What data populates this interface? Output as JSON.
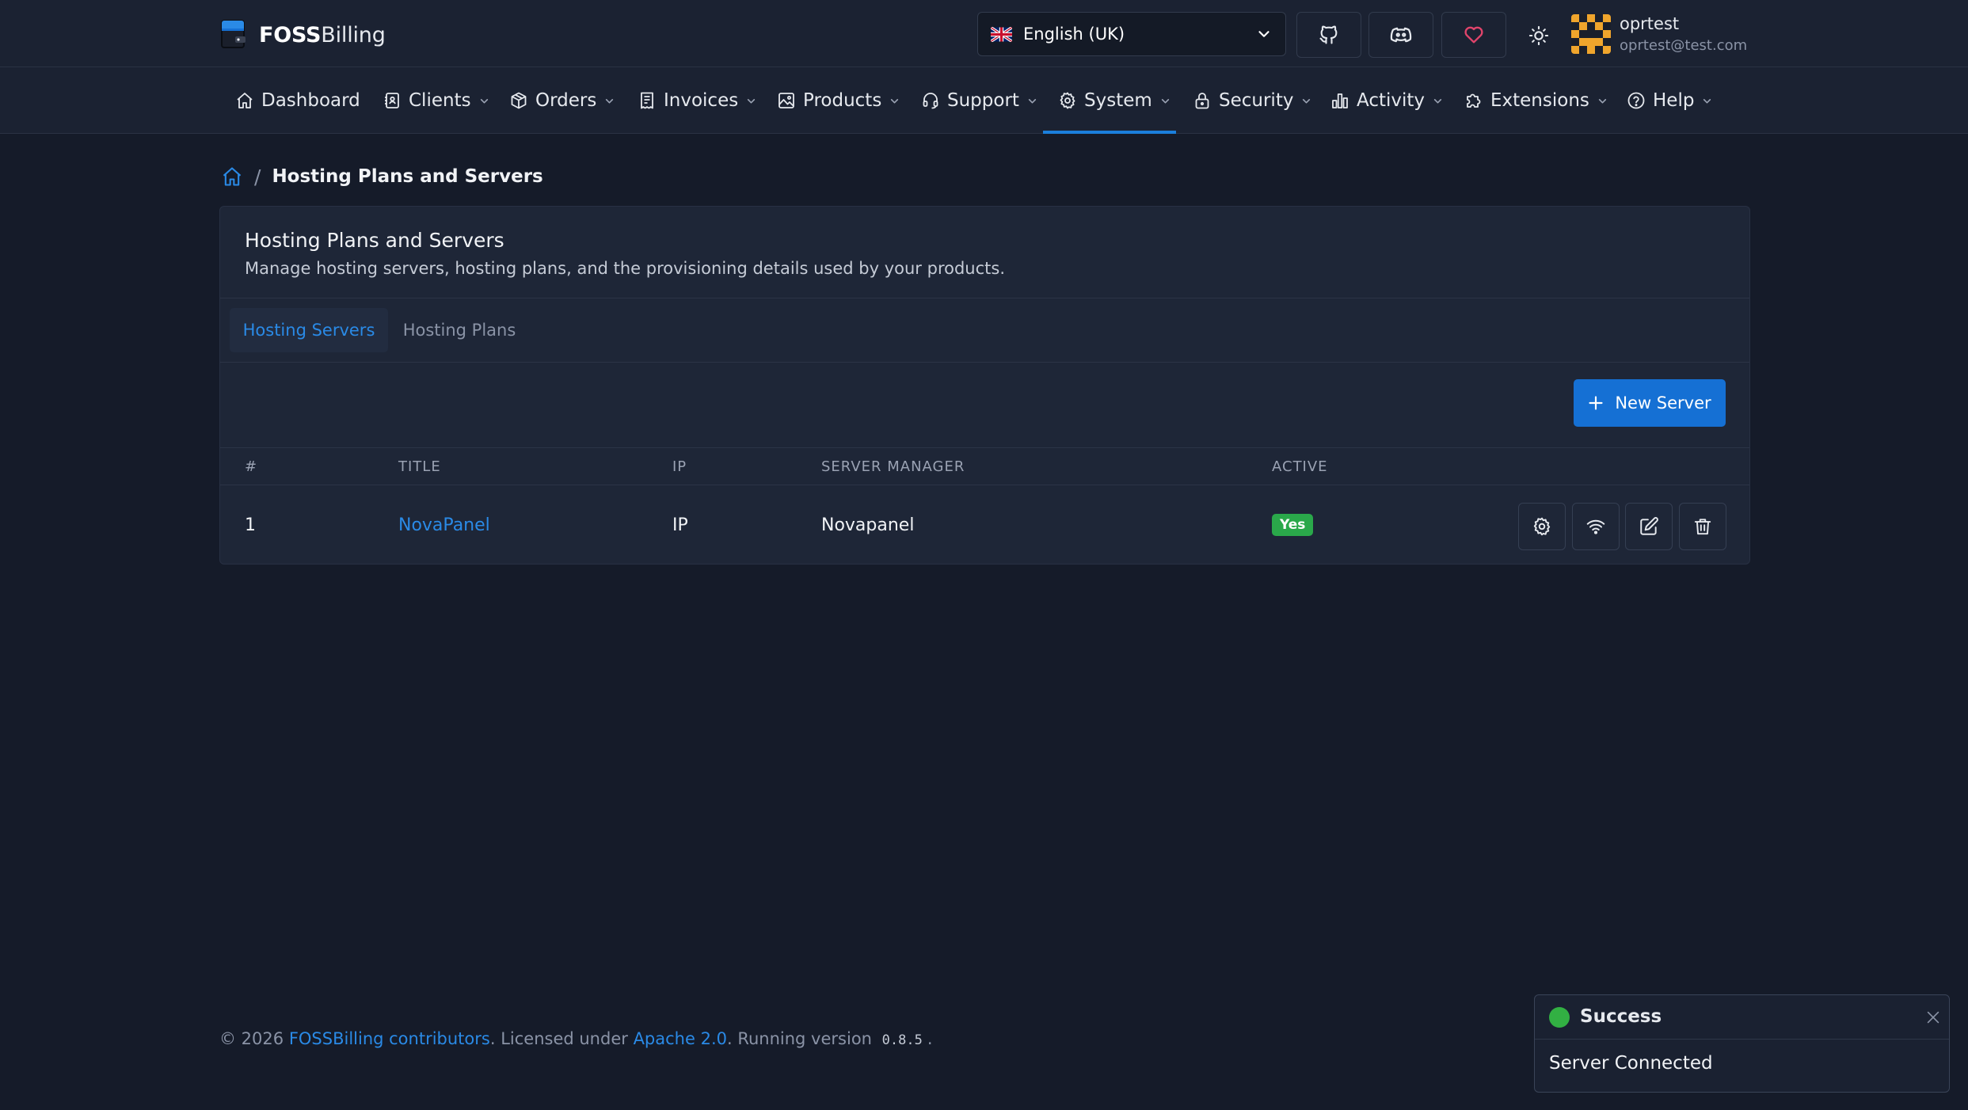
{
  "brand": {
    "name_bold": "FOSS",
    "name_regular": "Billing"
  },
  "header": {
    "language": "English (UK)",
    "user_name": "oprtest",
    "user_email": "oprtest@test.com"
  },
  "nav": {
    "items": [
      {
        "label": "Dashboard",
        "icon": "home-icon"
      },
      {
        "label": "Clients",
        "icon": "contacts-icon"
      },
      {
        "label": "Orders",
        "icon": "box-icon"
      },
      {
        "label": "Invoices",
        "icon": "receipt-icon"
      },
      {
        "label": "Products",
        "icon": "image-icon"
      },
      {
        "label": "Support",
        "icon": "headset-icon"
      },
      {
        "label": "System",
        "icon": "gear-icon",
        "active": true
      },
      {
        "label": "Security",
        "icon": "lock-icon"
      },
      {
        "label": "Activity",
        "icon": "bar-chart-icon"
      },
      {
        "label": "Extensions",
        "icon": "puzzle-icon"
      },
      {
        "label": "Help",
        "icon": "help-circle-icon"
      }
    ]
  },
  "breadcrumb": {
    "current": "Hosting Plans and Servers"
  },
  "card": {
    "title": "Hosting Plans and Servers",
    "subtitle": "Manage hosting servers, hosting plans, and the provisioning details used by your products.",
    "tabs": [
      {
        "label": "Hosting Servers",
        "active": true
      },
      {
        "label": "Hosting Plans",
        "active": false
      }
    ],
    "new_server_label": "New Server",
    "table": {
      "columns": [
        "#",
        "TITLE",
        "IP",
        "SERVER MANAGER",
        "ACTIVE"
      ],
      "rows": [
        {
          "id": "1",
          "title": "NovaPanel",
          "ip": "IP",
          "manager": "Novapanel",
          "active": "Yes"
        }
      ]
    }
  },
  "footer": {
    "copyright": "© 2026",
    "contributors_link": "FOSSBilling contributors",
    "licensed_text": ". Licensed under",
    "license_link": "Apache 2.0",
    "running_text": ". Running version",
    "version": "0.8.5",
    "end": "."
  },
  "toast": {
    "title": "Success",
    "message": "Server Connected"
  },
  "colors": {
    "background": "#151b29",
    "bar": "#1b2232",
    "card": "#1e2637",
    "accent": "#1570d4",
    "link": "#2a8ae6",
    "success": "#2aa84a",
    "heart": "#e0446b"
  }
}
